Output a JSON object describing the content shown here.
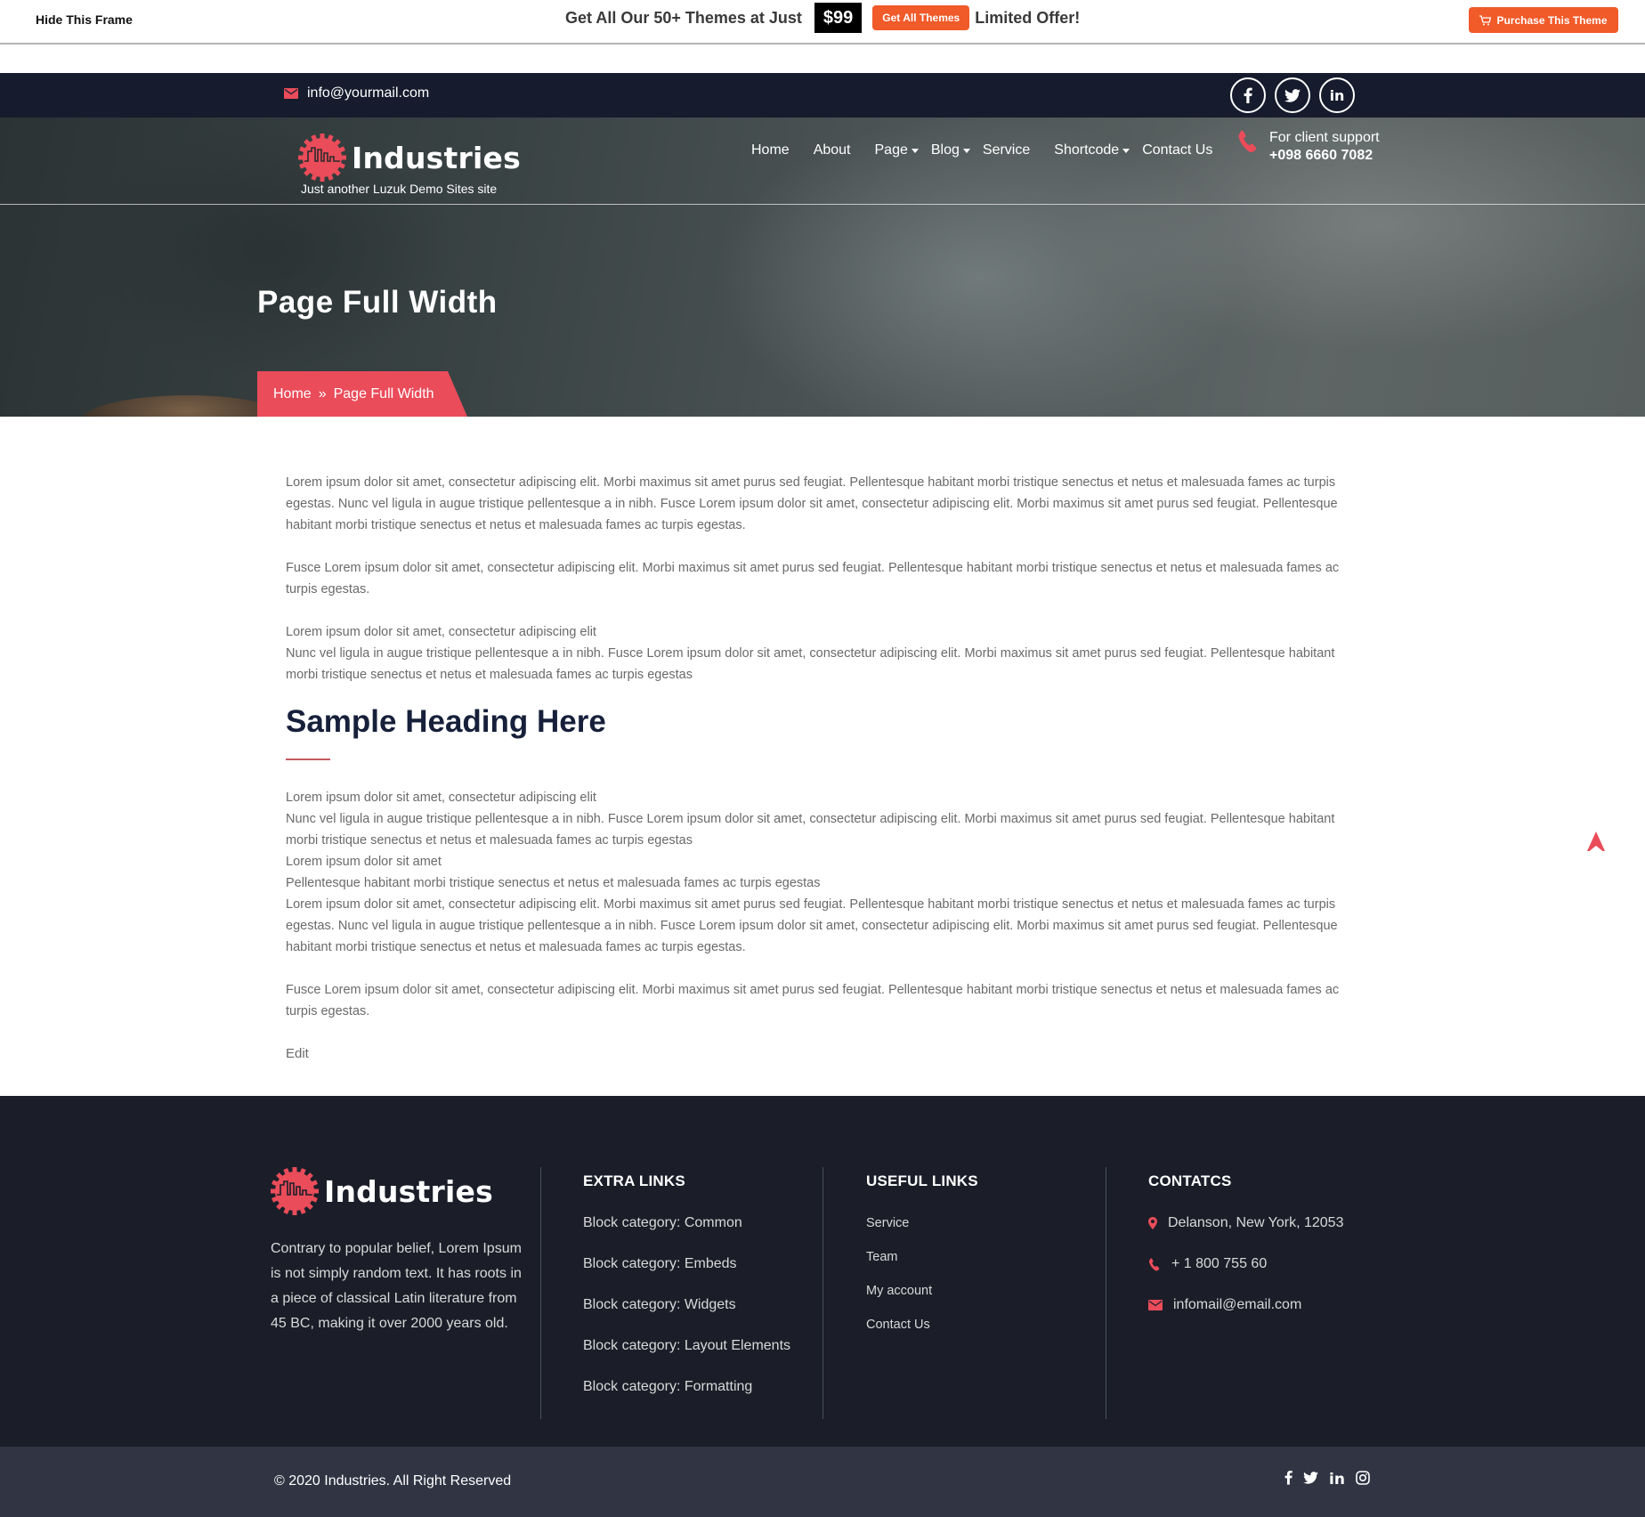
{
  "promo": {
    "hide_frame": "Hide This Frame",
    "offer_text": "Get All Our 50+ Themes at Just",
    "price": "$99",
    "get_all_button": "Get All Themes",
    "limited_offer": "Limited Offer!",
    "purchase_button": "Purchase This Theme",
    "purchase_icon": "cart-icon",
    "accent": "#f15a29"
  },
  "topbar": {
    "email": "info@yourmail.com",
    "email_icon": "envelope-icon",
    "socials": [
      {
        "icon": "facebook-icon",
        "glyph": "f"
      },
      {
        "icon": "twitter-icon",
        "glyph": "🐦"
      },
      {
        "icon": "linkedin-icon",
        "glyph": "in"
      }
    ]
  },
  "header": {
    "logo_text": "Industries",
    "tagline": "Just another Luzuk Demo Sites site",
    "nav": [
      {
        "label": "Home",
        "dropdown": false
      },
      {
        "label": "About",
        "dropdown": false
      },
      {
        "label": "Page",
        "dropdown": true
      },
      {
        "label": "Blog",
        "dropdown": true
      },
      {
        "label": "Service",
        "dropdown": false
      },
      {
        "label": "Shortcode",
        "dropdown": true
      },
      {
        "label": "Contact Us",
        "dropdown": false
      }
    ],
    "support_label": "For client support",
    "support_phone": "+098 6660 7082",
    "brand_color": "#ea4c5a"
  },
  "hero": {
    "title": "Page Full Width",
    "breadcrumb": {
      "home": "Home",
      "separator": "»",
      "current": "Page Full Width"
    }
  },
  "content": {
    "para1": "Lorem ipsum dolor sit amet, consectetur adipiscing elit. Morbi maximus sit amet purus sed feugiat. Pellentesque habitant morbi tristique senectus et netus et malesuada fames ac turpis egestas. Nunc vel ligula in augue tristique pellentesque a in nibh. Fusce Lorem ipsum dolor sit amet, consectetur adipiscing elit. Morbi maximus sit amet purus sed feugiat. Pellentesque habitant morbi tristique senectus et netus et malesuada fames ac turpis egestas.",
    "para2": "Fusce Lorem ipsum dolor sit amet, consectetur adipiscing elit. Morbi maximus sit amet purus sed feugiat. Pellentesque habitant morbi tristique senectus et netus et malesuada fames ac turpis egestas.",
    "para3_line1": "Lorem ipsum dolor sit amet, consectetur adipiscing elit",
    "para3_line2": "Nunc vel ligula in augue tristique pellentesque a in nibh. Fusce Lorem ipsum dolor sit amet, consectetur adipiscing elit. Morbi maximus sit amet purus sed feugiat. Pellentesque habitant morbi tristique senectus et netus et malesuada fames ac turpis egestas",
    "heading": "Sample Heading Here",
    "block_lines": [
      "Lorem ipsum dolor sit amet, consectetur adipiscing elit",
      "Nunc vel ligula in augue tristique pellentesque a in nibh. Fusce Lorem ipsum dolor sit amet, consectetur adipiscing elit. Morbi maximus sit amet purus sed feugiat. Pellentesque habitant morbi tristique senectus et netus et malesuada fames ac turpis egestas",
      "Lorem ipsum dolor sit amet",
      "Pellentesque habitant morbi tristique senectus et netus et malesuada fames ac turpis egestas",
      "Lorem ipsum dolor sit amet, consectetur adipiscing elit. Morbi maximus sit amet purus sed feugiat. Pellentesque habitant morbi tristique senectus et netus et malesuada fames ac turpis egestas. Nunc vel ligula in augue tristique pellentesque a in nibh. Fusce Lorem ipsum dolor sit amet, consectetur adipiscing elit. Morbi maximus sit amet purus sed feugiat. Pellentesque habitant morbi tristique senectus et netus et malesuada fames ac turpis egestas."
    ],
    "para_last": "Fusce Lorem ipsum dolor sit amet, consectetur adipiscing elit. Morbi maximus sit amet purus sed feugiat. Pellentesque habitant morbi tristique senectus et netus et malesuada fames ac turpis egestas.",
    "edit_link": "Edit",
    "scroll_top_icon": "arrow-up-icon"
  },
  "footer": {
    "logo_text": "Industries",
    "description": "Contrary to popular belief, Lorem Ipsum is not simply random text. It has roots in a piece of classical Latin literature from 45 BC, making it over 2000 years old.",
    "extra_links": {
      "title": "EXTRA LINKS",
      "items": [
        "Block category: Common",
        "Block category: Embeds",
        "Block category: Widgets",
        "Block category: Layout Elements",
        "Block category: Formatting"
      ]
    },
    "useful_links": {
      "title": "USEFUL LINKS",
      "items": [
        "Service",
        "Team",
        "My account",
        "Contact Us"
      ]
    },
    "contacts": {
      "title": "CONTATCS",
      "address": "Delanson, New York, 12053",
      "phone": "+ 1 800 755 60",
      "email": "infomail@email.com"
    },
    "copyright": "© 2020 Industries. All Right Reserved",
    "socials": [
      {
        "icon": "facebook-icon",
        "glyph": "f"
      },
      {
        "icon": "twitter-icon",
        "glyph": "🐦"
      },
      {
        "icon": "linkedin-icon",
        "glyph": "in"
      },
      {
        "icon": "instagram-icon",
        "glyph": "◎"
      }
    ]
  }
}
